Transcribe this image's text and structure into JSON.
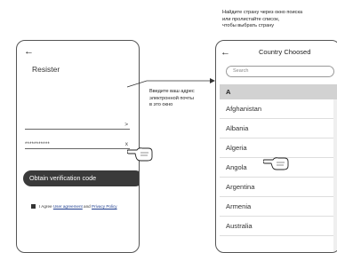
{
  "left_screen": {
    "back_icon": "←",
    "title": "Resister",
    "email_field": {
      "value": "",
      "suffix": ">"
    },
    "password_field": {
      "value": "***********",
      "suffix": "x"
    },
    "obtain_button": "Obtain verification  code",
    "agreement": {
      "prefix": "I Agree ",
      "user_agreement": "User agreement",
      "and": " and ",
      "privacy_policy": "Privacy Policy"
    }
  },
  "right_screen": {
    "back_icon": "←",
    "title": "Country Choosed",
    "search_placeholder": "Search",
    "section_header": "A",
    "countries": [
      "Afghanistan",
      "Albania",
      "Algeria",
      "Angola",
      "Argentina",
      "Armenia",
      "Australia"
    ]
  },
  "instructions": {
    "email": [
      "Введите ваш адрес",
      "электронной почты",
      "в это окно"
    ],
    "country": [
      "Найдите страну через окно поиска",
      "или пролистайте список,",
      "чтобы выбрать страну"
    ]
  },
  "icons": [
    "back-arrow-icon",
    "pointing-hand-icon",
    "arrow-right-icon"
  ]
}
